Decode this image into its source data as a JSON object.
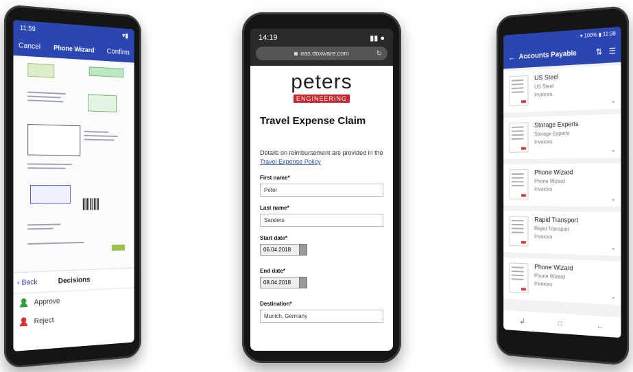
{
  "phone1": {
    "status_time": "11:59",
    "status_right": "▾▮",
    "cancel_label": "Cancel",
    "title": "Phone Wizard",
    "confirm_label": "Confirm",
    "back_label": "Back",
    "decisions_title": "Decisions",
    "approve_label": "Approve",
    "reject_label": "Reject",
    "colors": {
      "header": "#2b46b0",
      "approve": "#2e9e3c",
      "reject": "#d6343b"
    }
  },
  "phone2": {
    "status_time": "14:19",
    "status_right": "▮▮ ●",
    "url": "eas.doxware.com",
    "logo_top": "peters",
    "logo_bottom": "ENGINEERING",
    "page_title": "Travel Expense Claim",
    "intro_text": "Details on reimbursement are provided in the",
    "policy_link": "Travel Expense Policy",
    "fields": [
      {
        "label": "First name*",
        "value": "Peter"
      },
      {
        "label": "Last name*",
        "value": "Sanders"
      }
    ],
    "start_date_label": "Start date*",
    "start_date_value": "06.04.2018",
    "end_date_label": "End date*",
    "end_date_value": "08.04.2018",
    "destination_label": "Destination*",
    "destination_value": "Munich, Germany"
  },
  "phone3": {
    "status_right": "▾ 100% ▮ 12:38",
    "title": "Accounts Payable",
    "sort_icon": "⇅",
    "list_icon": "☰",
    "items": [
      {
        "name": "US Steel",
        "sub1": "US Steel",
        "sub2": "Invoices"
      },
      {
        "name": "Storage Experts",
        "sub1": "Storage Experts",
        "sub2": "Invoices"
      },
      {
        "name": "Phone Wizard",
        "sub1": "Phone Wizard",
        "sub2": "Invoices"
      },
      {
        "name": "Rapid Transport",
        "sub1": "Rapid Transport",
        "sub2": "Invoices"
      },
      {
        "name": "Phone Wizard",
        "sub1": "Phone Wizard",
        "sub2": "Invoices"
      }
    ]
  }
}
